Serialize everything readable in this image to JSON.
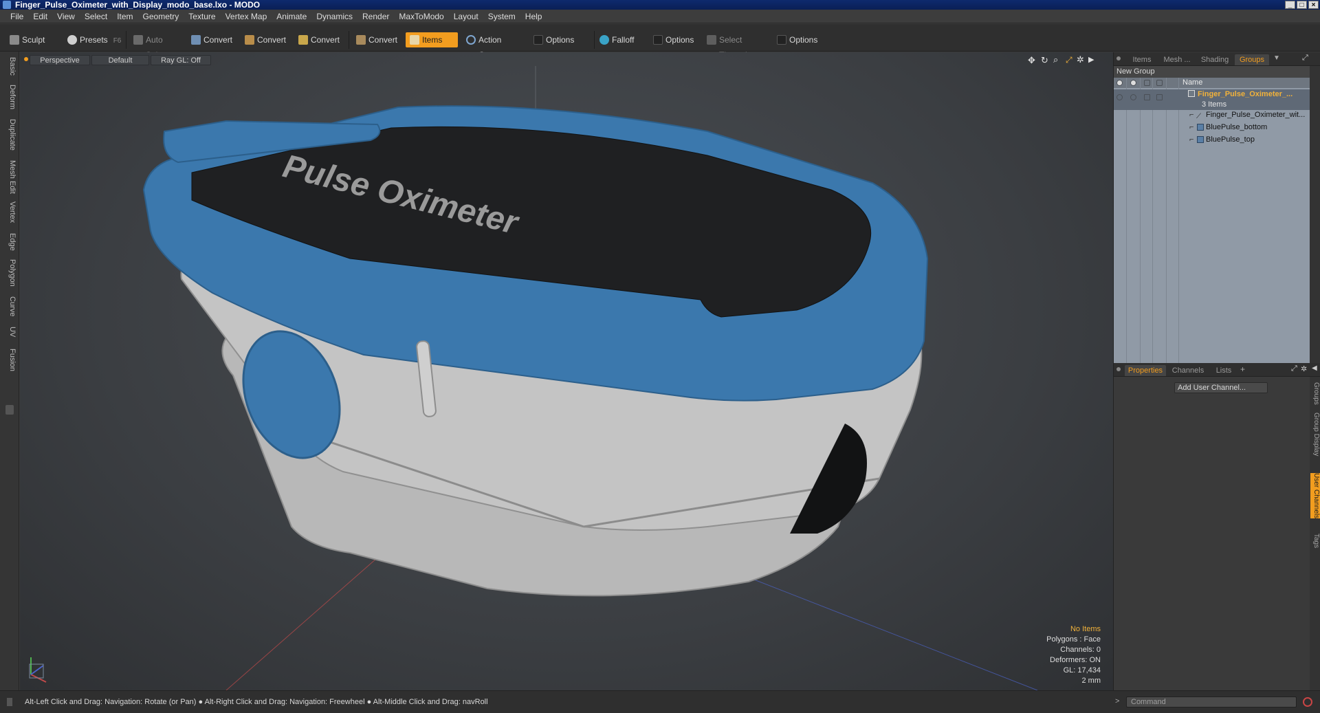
{
  "window": {
    "title": "Finger_Pulse_Oximeter_with_Display_modo_base.lxo - MODO"
  },
  "menu": [
    "File",
    "Edit",
    "View",
    "Select",
    "Item",
    "Geometry",
    "Texture",
    "Vertex Map",
    "Animate",
    "Dynamics",
    "Render",
    "MaxToModo",
    "Layout",
    "System",
    "Help"
  ],
  "toolbar": {
    "sculpt": "Sculpt",
    "presets": "Presets",
    "presets_key": "F6",
    "auto_select": "Auto Select",
    "convert1": "Convert",
    "convert2": "Convert",
    "convert3": "Convert",
    "convert4": "Convert",
    "items": "Items",
    "action_center": "Action Center",
    "options1": "Options",
    "falloff": "Falloff",
    "options2": "Options",
    "select_through": "Select Through",
    "options3": "Options"
  },
  "left_tabs": [
    "Basic",
    "Deform",
    "Duplicate",
    "Mesh Edit",
    "Vertex",
    "Edge",
    "Polygon",
    "Curve",
    "UV",
    "Fusion"
  ],
  "viewport": {
    "view": "Perspective",
    "shading": "Default",
    "raygl": "Ray GL: Off",
    "model_label": "Pulse Oximeter",
    "stats": {
      "items": "No Items",
      "polygons": "Polygons : Face",
      "channels": "Channels: 0",
      "deformers": "Deformers: ON",
      "gl": "GL: 17,434",
      "scale": "2 mm"
    }
  },
  "right_panel": {
    "top_tabs": [
      "Items",
      "Mesh ...",
      "Shading",
      "Groups"
    ],
    "active_top_tab": "Groups",
    "new_group": "New Group",
    "name_header": "Name",
    "group_name": "Finger_Pulse_Oximeter_...",
    "group_count": "3 Items",
    "children": [
      "Finger_Pulse_Oximeter_wit...",
      "BluePulse_bottom",
      "BluePulse_top"
    ],
    "bottom_tabs": [
      "Properties",
      "Channels",
      "Lists"
    ],
    "add_user_channel": "Add User Channel...",
    "side_tabs": [
      "Groups",
      "Group Display",
      "User Channels",
      "Tags"
    ]
  },
  "status": {
    "hint": "Alt-Left Click and Drag: Navigation: Rotate (or Pan) ● Alt-Right Click and Drag: Navigation: Freewheel ● Alt-Middle Click and Drag: navRoll",
    "command_placeholder": "Command"
  },
  "colors": {
    "accent": "#f29d1f",
    "model_blue": "#3b78ad",
    "model_gray": "#b9b9b9",
    "model_dark": "#1f2022"
  }
}
